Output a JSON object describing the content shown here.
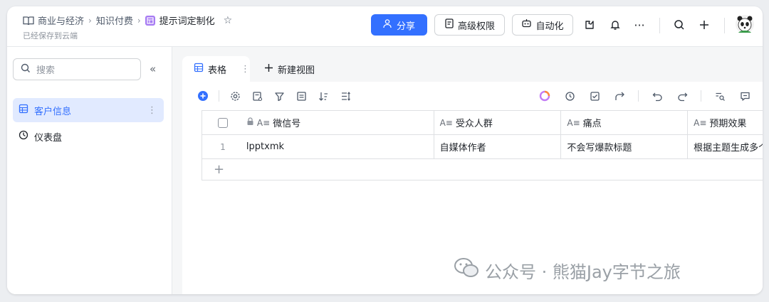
{
  "breadcrumb": {
    "items": [
      "商业与经济",
      "知识付费"
    ],
    "current": "提示词定制化",
    "saved_status": "已经保存到云端"
  },
  "header_actions": {
    "share_label": "分享",
    "permission_label": "高级权限",
    "automation_label": "自动化"
  },
  "sidebar": {
    "search_placeholder": "搜索",
    "items": [
      {
        "label": "客户信息",
        "icon": "grid-table-icon",
        "active": true
      },
      {
        "label": "仪表盘",
        "icon": "dashboard-icon",
        "active": false
      }
    ]
  },
  "tabs": {
    "active_label": "表格",
    "new_view_label": "新建视图"
  },
  "table": {
    "columns": [
      "微信号",
      "受众人群",
      "痛点",
      "预期效果"
    ],
    "rows": [
      {
        "num": "1",
        "cells": [
          "lpptxmk",
          "自媒体作者",
          "不会写爆款标题",
          "根据主题生成多个"
        ]
      }
    ],
    "add_symbol": "+"
  },
  "watermark": {
    "text": "公众号 · 熊猫Jay字节之旅"
  },
  "colors": {
    "accent": "#3370ff",
    "sidebar_active_bg": "#e1eaff",
    "doc_icon": "#a77bf3"
  }
}
